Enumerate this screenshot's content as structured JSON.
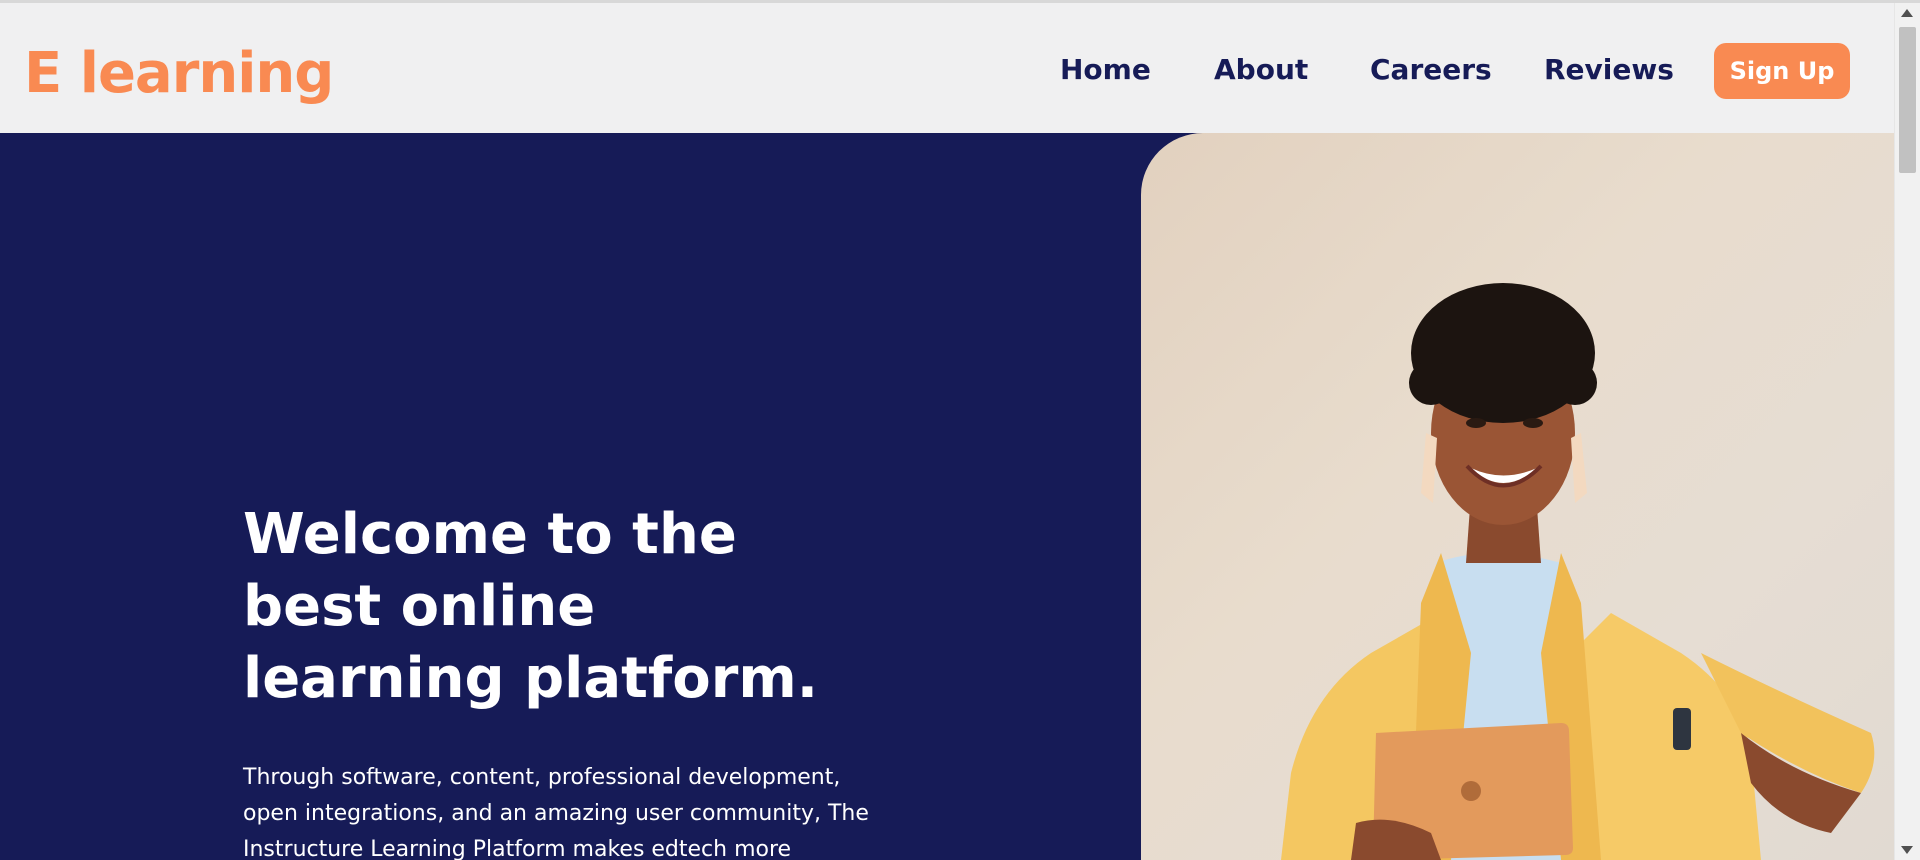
{
  "brand": {
    "logo": "E learning",
    "accent_color": "#f98a52",
    "navy_color": "#161b57"
  },
  "nav": {
    "items": [
      {
        "label": "Home"
      },
      {
        "label": "About"
      },
      {
        "label": "Careers"
      },
      {
        "label": "Reviews"
      }
    ],
    "signup_label": "Sign Up"
  },
  "hero": {
    "title": "Welcome to the best online learning platform.",
    "text": "Through software, content, professional development, open integrations, and an amazing user community, The Instructure Learning Platform makes edtech more",
    "image": {
      "description_icon": "woman-holding-tablet-photo"
    }
  }
}
